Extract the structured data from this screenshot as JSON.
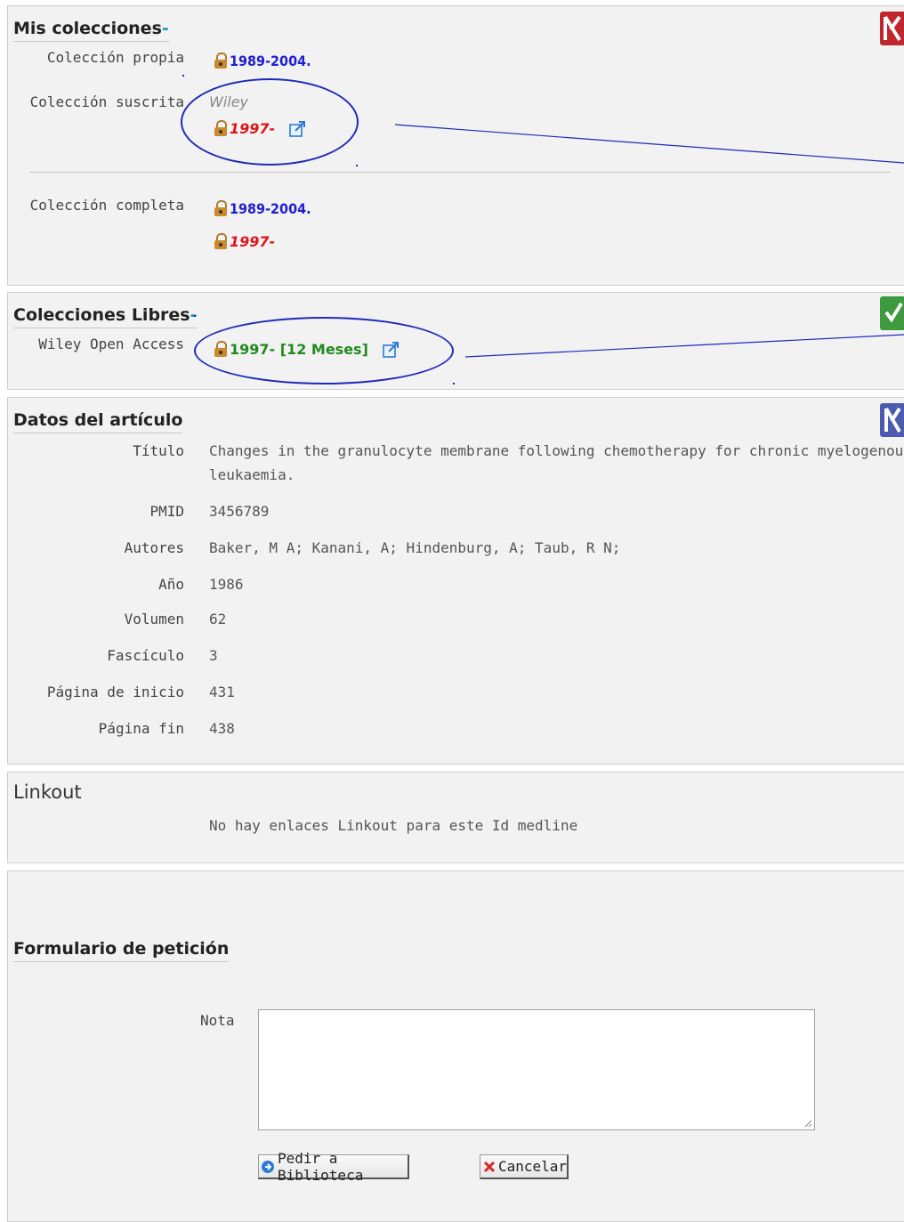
{
  "mis_colecciones": {
    "heading": "Mis colecciones",
    "dash": "-",
    "coleccion_propia": {
      "label": "Colección propia",
      "range": "1989-2004."
    },
    "coleccion_suscrita": {
      "label": "Colección suscrita",
      "provider": "Wiley",
      "range": "1997-"
    },
    "coleccion_completa": {
      "label": "Colección completa",
      "range1": "1989-2004.",
      "range2": "1997-"
    }
  },
  "colecciones_libres": {
    "heading": "Colecciones Libres",
    "dash": "-",
    "label": "Wiley Open Access",
    "range": "1997- [12 Meses]"
  },
  "datos_articulo": {
    "heading": "Datos del artículo",
    "rows": [
      {
        "label": "Título",
        "value": "Changes in the granulocyte membrane following chemotherapy for chronic myelogenous",
        "value2": "leukaemia."
      },
      {
        "label": "PMID",
        "value": "3456789"
      },
      {
        "label": "Autores",
        "value": "Baker, M A; Kanani, A; Hindenburg, A; Taub, R N;"
      },
      {
        "label": "Año",
        "value": "1986"
      },
      {
        "label": "Volumen",
        "value": "62"
      },
      {
        "label": "Fascículo",
        "value": "3"
      },
      {
        "label": "Página de inicio",
        "value": "431"
      },
      {
        "label": "Página fin",
        "value": "438"
      }
    ]
  },
  "linkout": {
    "heading": "Linkout",
    "message": "No hay enlaces Linkout para este Id medline"
  },
  "formulario": {
    "heading": "Formulario de petición",
    "nota_label": "Nota",
    "nota_value": "",
    "pedir_label": "Pedir a Biblioteca",
    "cancelar_label": "Cancelar"
  },
  "icons": {
    "lock": "lock-icon",
    "external": "external-link-icon",
    "section_red": "red-section-icon",
    "section_green": "green-check-icon",
    "section_blue": "blue-section-icon"
  },
  "colors": {
    "annotation": "#1c2ab8",
    "blue_link": "#1f1fd1",
    "red_link": "#e0141a",
    "green_link": "#1f8a1f"
  }
}
